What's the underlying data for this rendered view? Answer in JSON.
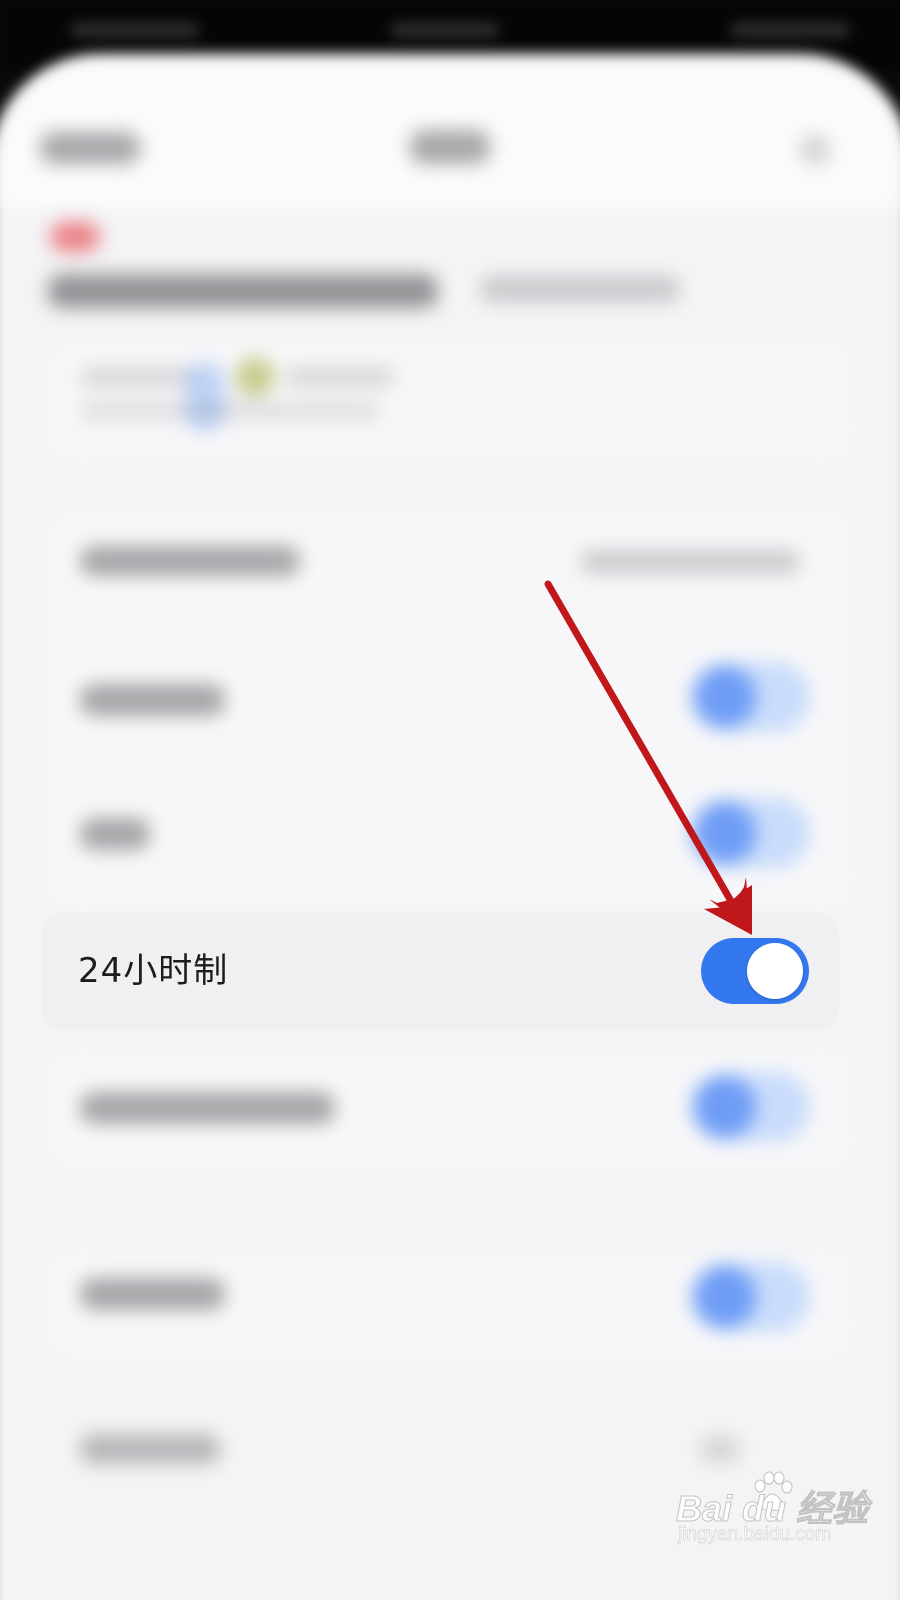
{
  "setting_row": {
    "label": "24小时制",
    "toggle_on": true
  },
  "colors": {
    "accent": "#3478f0",
    "row_background": "#f0f0f2",
    "annotation_arrow": "#c0171b"
  },
  "watermark": {
    "brand": "Bai du 经验",
    "url": "jingyan.baidu.com"
  }
}
